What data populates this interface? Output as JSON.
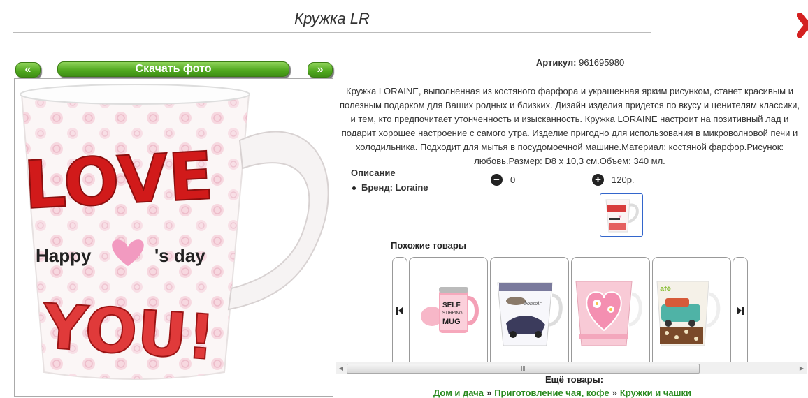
{
  "page": {
    "title": "Кружка LR"
  },
  "gallery": {
    "prev_label": "«",
    "download_label": "Скачать фото",
    "next_label": "»",
    "photo": {
      "text_top": "LOVE",
      "text_mid_left": "Happy",
      "text_mid_right": "'s day",
      "text_bottom": "YOU!"
    }
  },
  "product": {
    "sku_label": "Артикул:",
    "sku_value": "961695980",
    "description": "Кружка LORAINE, выполненная из костяного фарфора и украшенная ярким рисунком, станет красивым и полезным подарком для Ваших родных и близких. Дизайн изделия придется по вкусу и ценителям классики, и тем, кто предпочитает утонченность и изысканность. Кружка LORAINE настроит на позитивный лад и подарит хорошее настроение с самого утра. Изделие пригодно для использования в микроволновой печи и холодильника. Подходит для мытья в посудомоечной машине.Материал: костяной фарфор.Рисунок: любовь.Размер: D8 х 10,3 см.Объем: 340 мл.",
    "spec_title": "Описание",
    "spec_brand": "Бренд: Loraine",
    "quantity": "0",
    "price": "120р."
  },
  "similar": {
    "title": "Похожие товары",
    "items": [
      {
        "mug_text": "SELF STIRRING MUG"
      },
      {
        "mug_text": ""
      },
      {
        "mug_text": ""
      },
      {
        "mug_text": ""
      }
    ]
  },
  "more": {
    "title": "Ещё товары:",
    "crumbs": [
      "Дом и дача",
      "Приготовление чая, кофе",
      "Кружки и чашки"
    ],
    "separator": "»"
  },
  "colors": {
    "accent_green": "#4fa71e",
    "link_green": "#2a8a1f",
    "close_red": "#d42020",
    "love_red": "#d11a1a",
    "heart_pink": "#f29ac0"
  },
  "icons": {
    "close": "close-x-icon",
    "minus": "minus-circle-icon",
    "plus": "plus-circle-icon",
    "carousel_prev": "skip-back-icon",
    "carousel_next": "skip-forward-icon"
  }
}
